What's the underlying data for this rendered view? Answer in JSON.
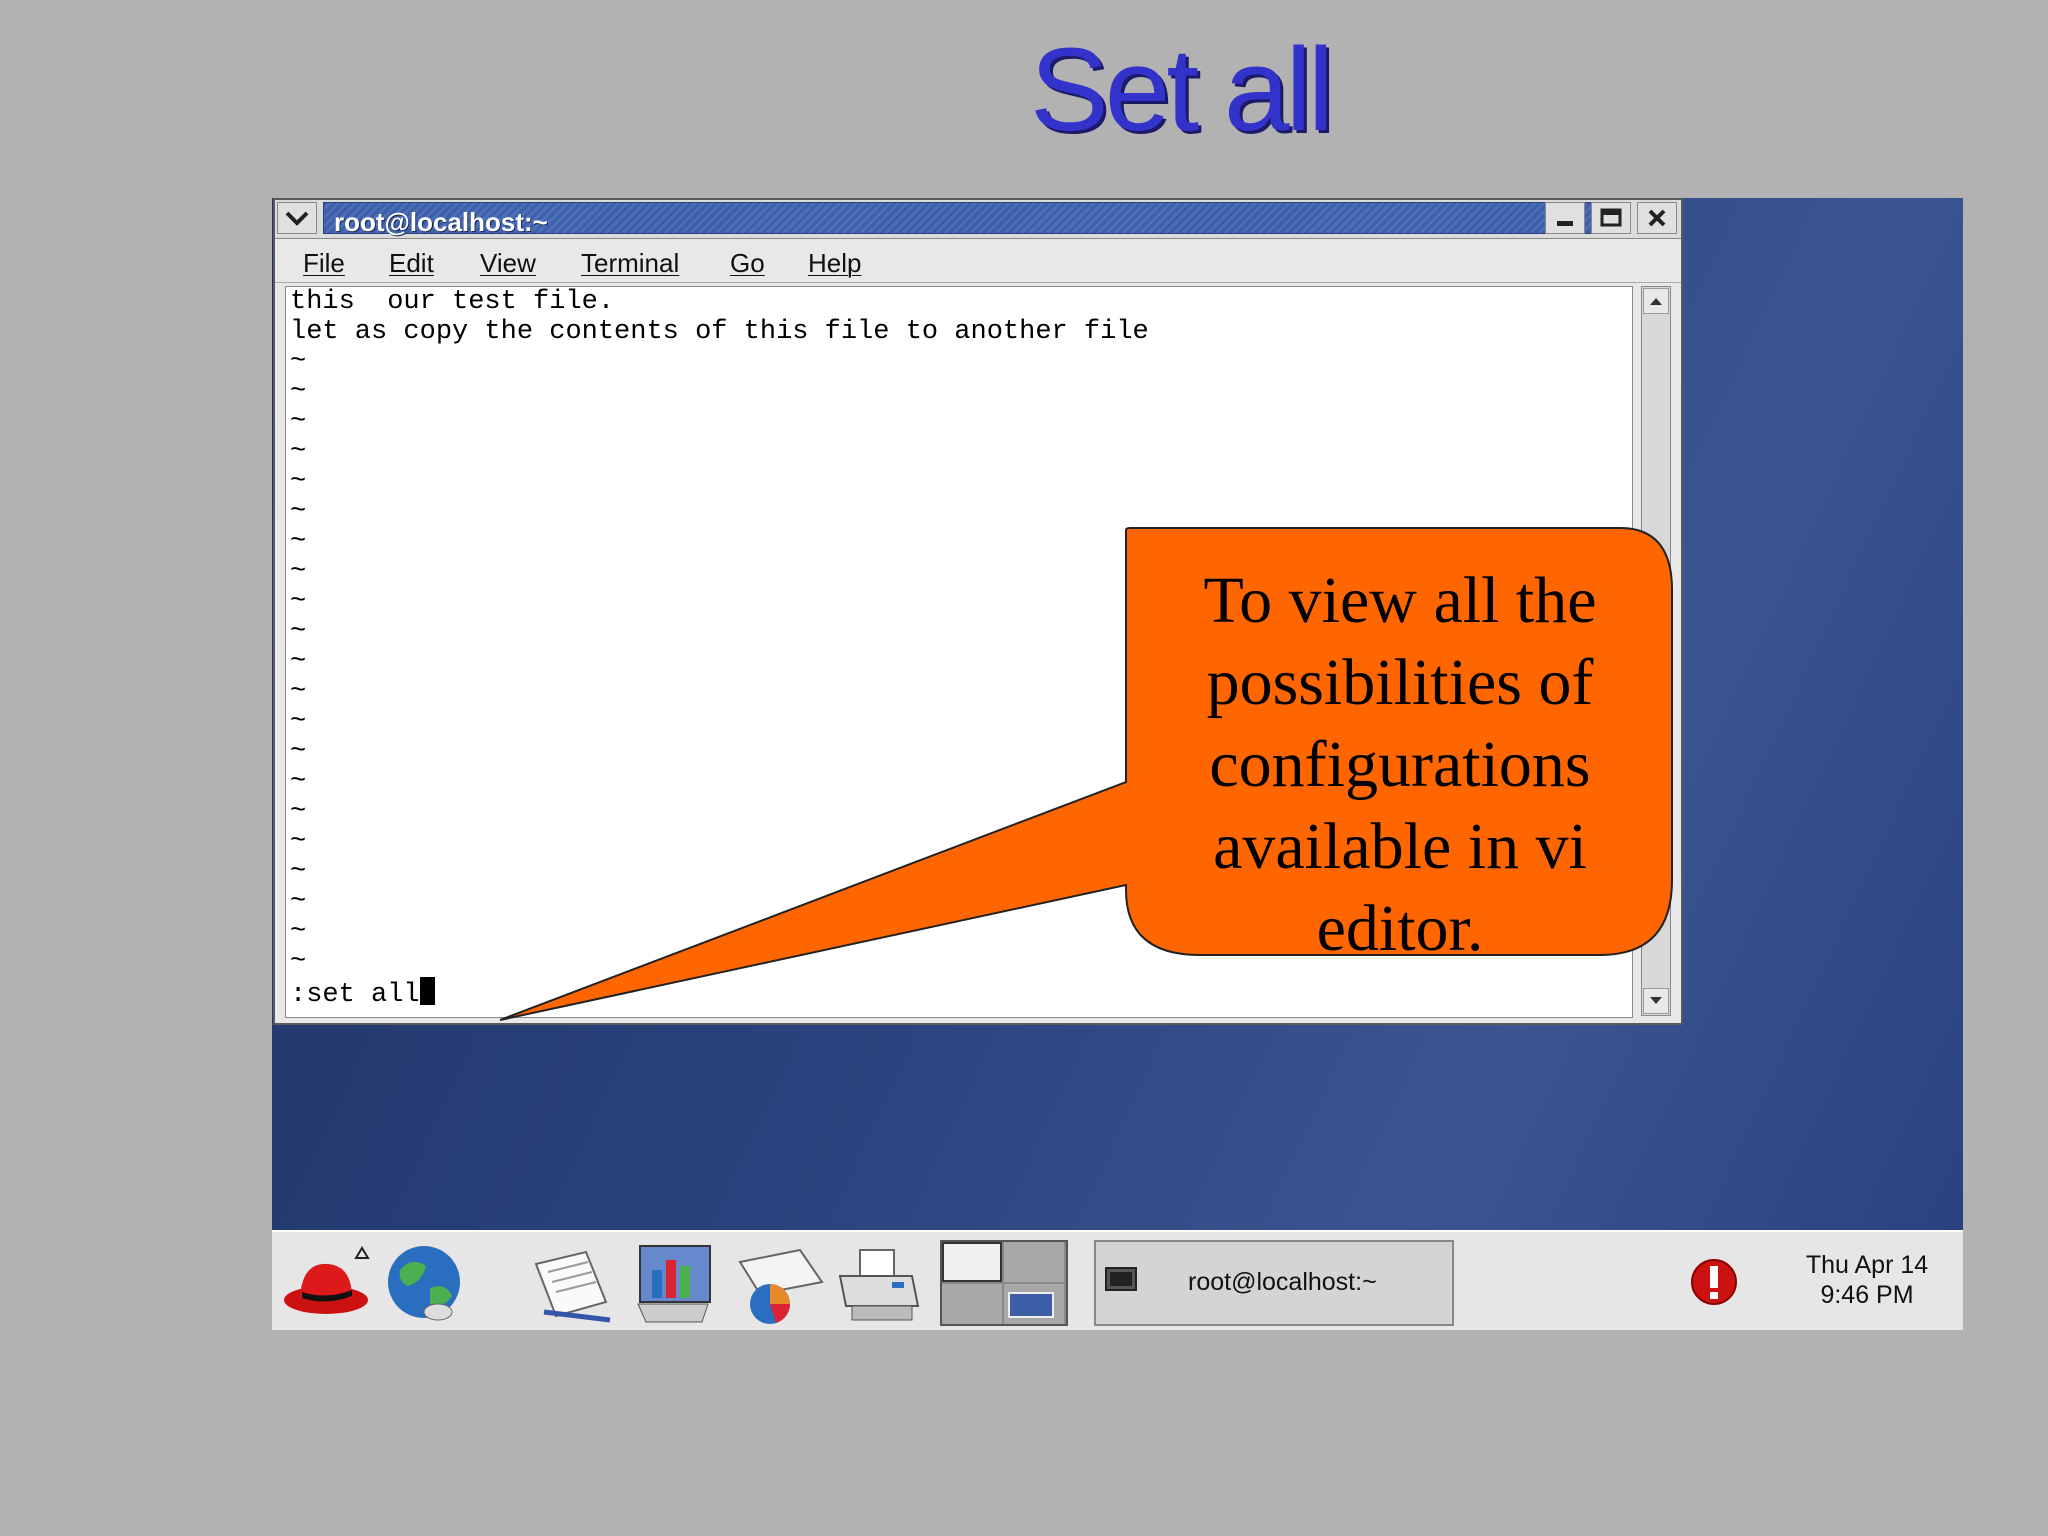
{
  "slide": {
    "title": "Set all"
  },
  "window": {
    "title": "root@localhost:~",
    "menu": [
      "File",
      "Edit",
      "View",
      "Terminal",
      "Go",
      "Help"
    ]
  },
  "terminal": {
    "lines": [
      "this  our test file.",
      "let as copy the contents of this file to another file"
    ],
    "tilde_count": 21,
    "tilde": "~",
    "command": ":set all"
  },
  "callout": {
    "text": "To view all the possibilities of configurations available in vi editor.",
    "color": "#ff6600"
  },
  "taskbar": {
    "launchers": [
      "redhat-menu-icon",
      "web-browser-icon",
      "text-editor-icon",
      "presentation-icon",
      "spreadsheet-icon",
      "printer-icon"
    ],
    "task_label": "root@localhost:~",
    "clock_date": "Thu Apr 14",
    "clock_time": "9:46 PM"
  }
}
